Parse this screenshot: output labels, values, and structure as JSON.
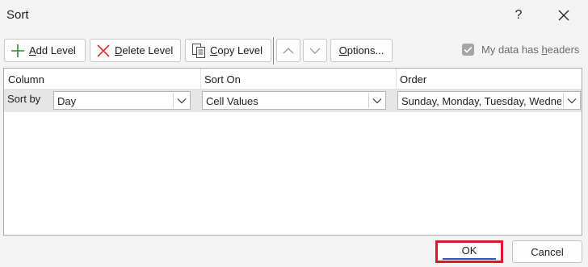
{
  "window": {
    "title": "Sort",
    "help_label": "?"
  },
  "toolbar": {
    "add_level": {
      "hotkey": "A",
      "rest": "dd Level"
    },
    "delete_level": {
      "hotkey": "D",
      "rest": "elete Level"
    },
    "copy_level": {
      "hotkey": "C",
      "rest": "opy Level"
    },
    "options": {
      "hotkey": "O",
      "rest": "ptions..."
    }
  },
  "headers_checkbox": {
    "label_pre": "My data has ",
    "hotkey": "h",
    "label_post": "eaders",
    "checked": true
  },
  "grid": {
    "columns": [
      "Column",
      "Sort On",
      "Order"
    ],
    "rows": [
      {
        "label": "Sort by",
        "column": "Day",
        "sort_on": "Cell Values",
        "order": "Sunday, Monday, Tuesday, Wednesday"
      }
    ]
  },
  "footer": {
    "ok_label": "OK",
    "cancel_label": "Cancel"
  },
  "colors": {
    "highlight": "#e0142a",
    "add_icon": "#2e8b3a",
    "delete_icon": "#d32f2f"
  }
}
